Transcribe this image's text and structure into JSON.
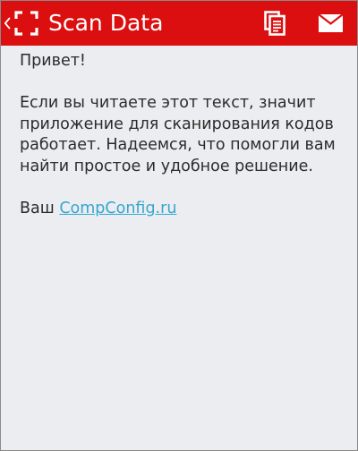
{
  "appbar": {
    "title": "Scan Data",
    "background": "#db0f0f",
    "back_icon": "chevron-left-icon",
    "app_icon": "scan-frame-icon",
    "actions": [
      {
        "icon": "copy-icon"
      },
      {
        "icon": "mail-icon"
      }
    ]
  },
  "content": {
    "greeting": "Привет!",
    "body": "Если вы читаете этот текст, значит приложение для сканирования кодов работает. Надеемся, что помогли вам найти простое и удобное решение.",
    "signature_prefix": "Ваш",
    "signature_link": "CompConfig.ru",
    "link_color": "#35a6cf"
  }
}
